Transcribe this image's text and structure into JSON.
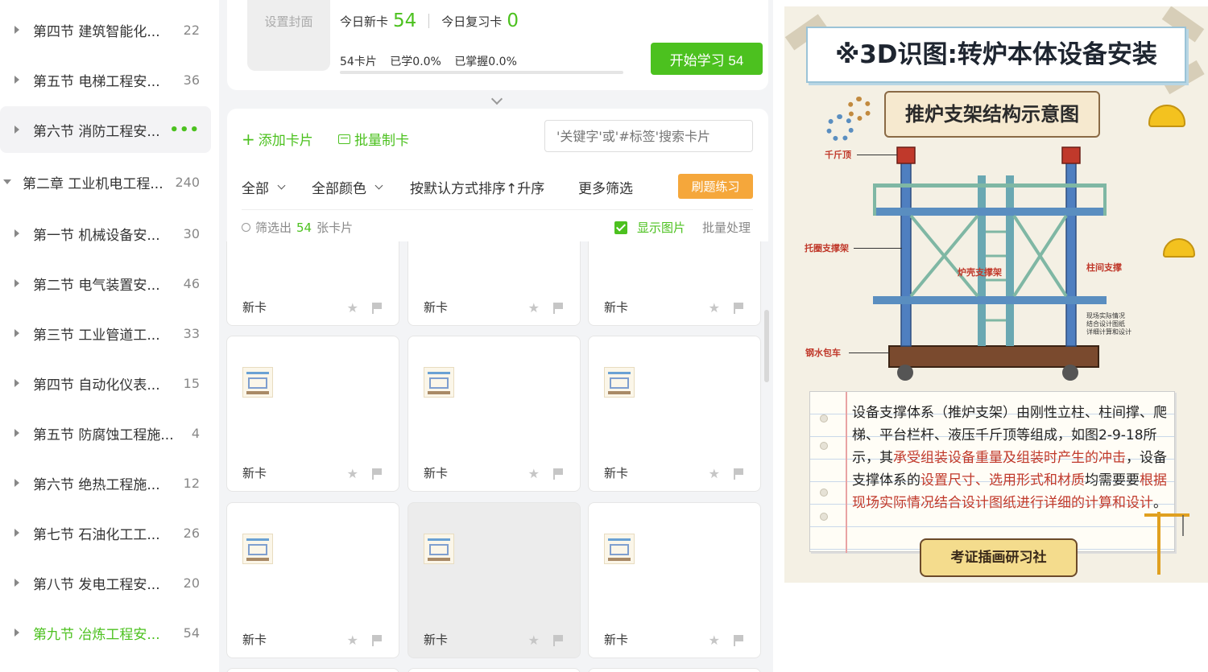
{
  "sidebar": {
    "items": [
      {
        "label": "第四节 建筑智能化...",
        "count": "22"
      },
      {
        "label": "第五节 电梯工程安...",
        "count": "36"
      },
      {
        "label": "第六节 消防工程安...",
        "count": "•••"
      },
      {
        "label": "第二章 工业机电工程...",
        "count": "240"
      },
      {
        "label": "第一节 机械设备安...",
        "count": "30"
      },
      {
        "label": "第二节 电气装置安...",
        "count": "46"
      },
      {
        "label": "第三节 工业管道工...",
        "count": "33"
      },
      {
        "label": "第四节 自动化仪表...",
        "count": "15"
      },
      {
        "label": "第五节 防腐蚀工程施...",
        "count": "4"
      },
      {
        "label": "第六节 绝热工程施...",
        "count": "12"
      },
      {
        "label": "第七节 石油化工工...",
        "count": "26"
      },
      {
        "label": "第八节 发电工程安...",
        "count": "20"
      },
      {
        "label": "第九节 冶炼工程安...",
        "count": "54"
      }
    ]
  },
  "deck": {
    "cover_label": "设置封面",
    "today_new_label": "今日新卡",
    "today_new_value": "54",
    "today_review_label": "今日复习卡",
    "today_review_value": "0",
    "cards_total": "54卡片",
    "learned": "已学0.0%",
    "mastered": "已掌握0.0%",
    "progress_learned": 0.0,
    "start_button": "开始学习 54"
  },
  "toolbar": {
    "add_card": "添加卡片",
    "batch_make": "批量制卡",
    "search_placeholder": "'关键字'或'#标签'搜索卡片",
    "filter_all": "全部",
    "filter_color": "全部颜色",
    "sort": "按默认方式排序↑升序",
    "more_filter": "更多筛选",
    "practice_button": "刷题练习",
    "result_prefix": "筛选出",
    "result_count": "54",
    "result_suffix": "张卡片",
    "show_images": "显示图片",
    "bulk_process": "批量处理"
  },
  "cards": {
    "new_label": "新卡"
  },
  "preview": {
    "title": "※3D识图:转炉本体设备安装",
    "subtitle": "推炉支架结构示意图",
    "labels": {
      "jack": "千斤顶",
      "ring_support": "托圈支撑架",
      "shell_support": "炉壳支撑架",
      "column_brace": "柱间支撑",
      "ladle_car": "钢水包车",
      "note": "现场实际情况\n结合设计图纸\n详细计算和设计"
    },
    "para_1": "设备支撑体系（推炉支架）由刚性立柱、柱间撑、爬梯、平台栏杆、液压千斤顶等组成，如图2-9-18所示，其",
    "para_hl_1": "承受组装设备重量及组装时产生的冲击",
    "para_2": "，设备支撑体系的",
    "para_hl_2": "设置尺寸、选用形式和材质",
    "para_3": "均需要要",
    "para_hl_3": "根据现场实际情况结合设计图纸进行详细的计算和设计",
    "para_4": "。",
    "banner": "考证插画研习社"
  },
  "colors": {
    "accent": "#4cc11f",
    "practice": "#f5a73b",
    "highlight": "#c0392b"
  }
}
